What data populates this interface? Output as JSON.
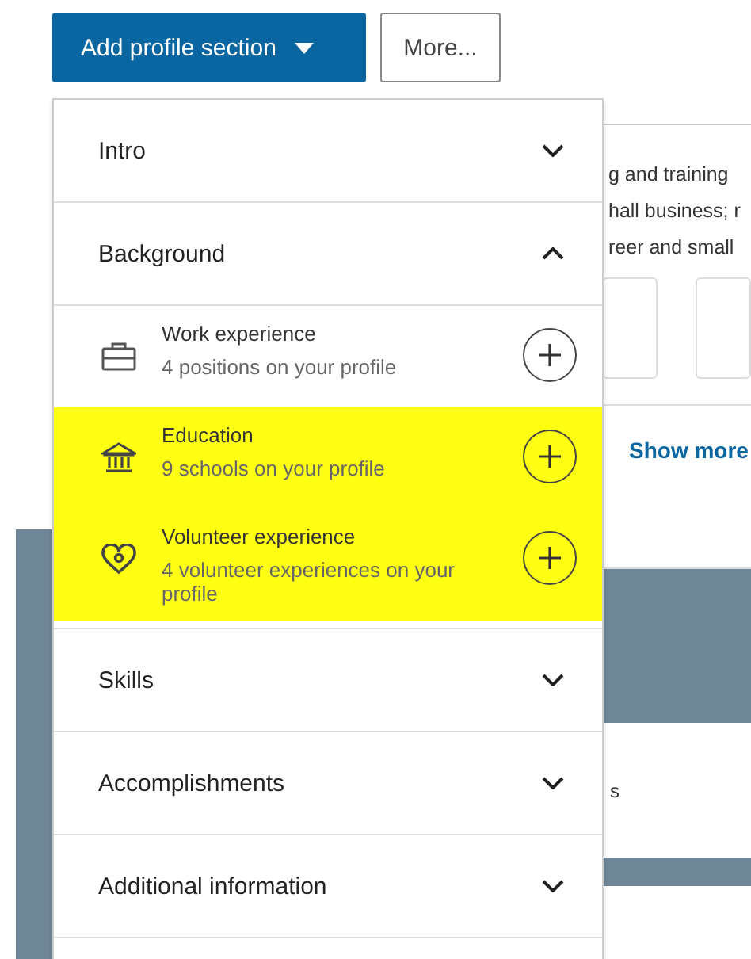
{
  "toolbar": {
    "primary_button": "Add profile section",
    "secondary_button": "More..."
  },
  "background_lines": [
    "g and training",
    "hall business; r",
    "reer and small"
  ],
  "show_more": "Show more",
  "card_fragment": "s",
  "menu": {
    "sections": [
      {
        "label": "Intro",
        "expanded": false
      },
      {
        "label": "Background",
        "expanded": true,
        "items": [
          {
            "kind": "briefcase",
            "title": "Work experience",
            "subtitle": "4 positions on your profile",
            "highlighted": false
          },
          {
            "kind": "school",
            "title": "Education",
            "subtitle": "9 schools on your profile",
            "highlighted": true
          },
          {
            "kind": "heart",
            "title": "Volunteer experience",
            "subtitle": "4 volunteer experiences on your profile",
            "highlighted": true
          }
        ]
      },
      {
        "label": "Skills",
        "expanded": false
      },
      {
        "label": "Accomplishments",
        "expanded": false
      },
      {
        "label": "Additional information",
        "expanded": false
      }
    ]
  }
}
